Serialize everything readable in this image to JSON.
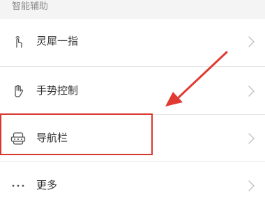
{
  "section": {
    "title": "智能辅助"
  },
  "items": [
    {
      "label": "灵犀一指",
      "icon": "finger-tap-icon"
    },
    {
      "label": "手势控制",
      "icon": "hand-gesture-icon"
    },
    {
      "label": "导航栏",
      "icon": "navigation-bar-icon"
    },
    {
      "label": "更多",
      "icon": "more-dots-icon"
    }
  ],
  "annotation": {
    "highlight_color": "#d9362e",
    "arrow_color": "#e03a32"
  }
}
